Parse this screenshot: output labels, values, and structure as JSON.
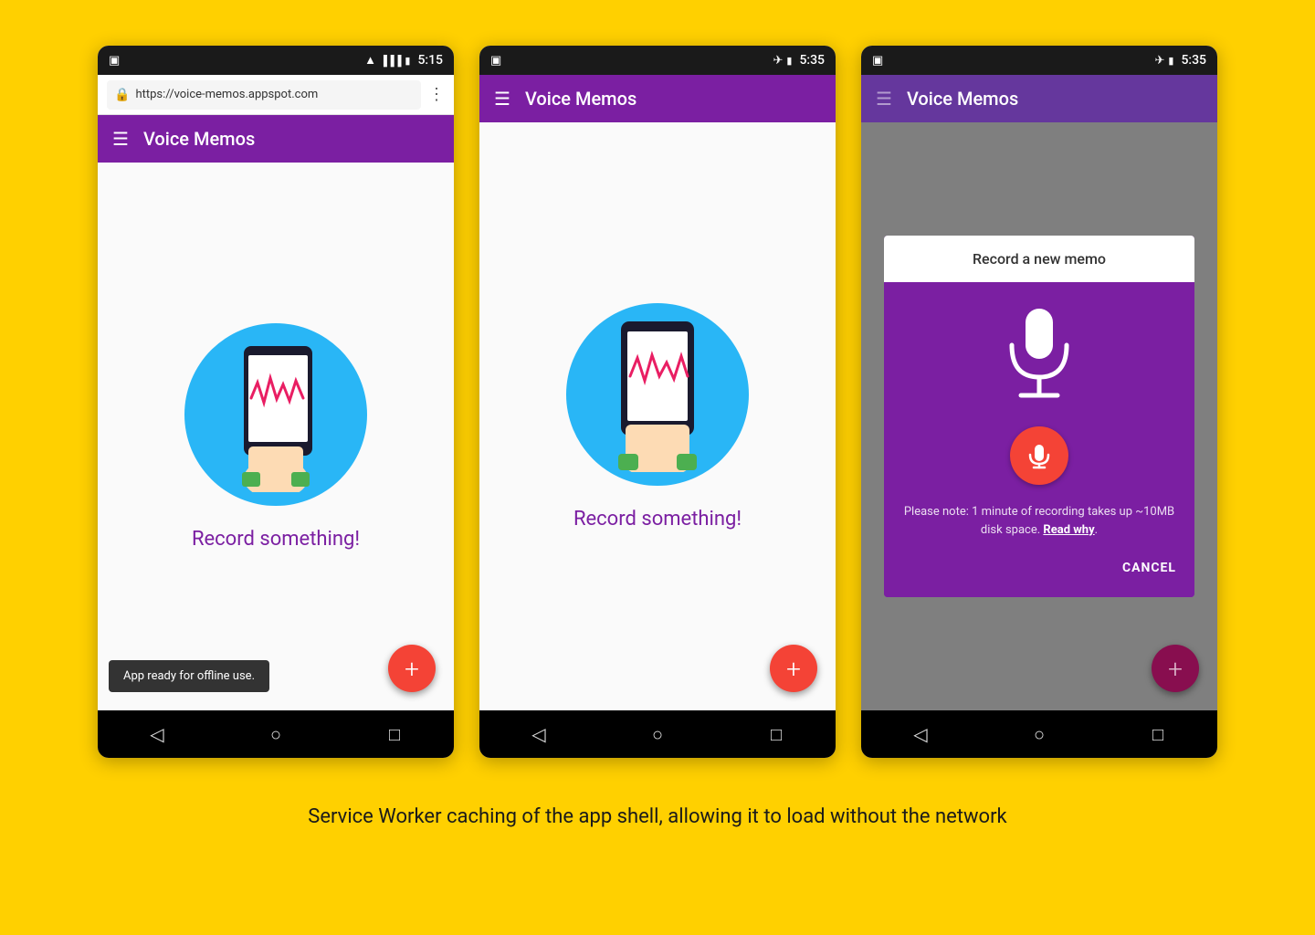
{
  "background": "#FFD000",
  "phones": [
    {
      "id": "phone1",
      "status_bar": {
        "left_icon": "tablet",
        "right_icons": [
          "wifi",
          "signal",
          "battery"
        ],
        "time": "5:15"
      },
      "has_browser_bar": true,
      "browser_url": "https://voice-memos.appspot.com",
      "app_bar": {
        "title": "Voice Memos",
        "icon": "menu"
      },
      "content": {
        "record_text": "Record something!",
        "has_illustration": true
      },
      "snackbar": "App ready for offline use.",
      "fab_label": "+",
      "nav": [
        "back",
        "home",
        "square"
      ]
    },
    {
      "id": "phone2",
      "status_bar": {
        "left_icon": "tablet",
        "right_icons": [
          "airplane",
          "battery"
        ],
        "time": "5:35"
      },
      "has_browser_bar": false,
      "app_bar": {
        "title": "Voice Memos",
        "icon": "menu"
      },
      "content": {
        "record_text": "Record something!",
        "has_illustration": true
      },
      "snackbar": null,
      "fab_label": "+",
      "nav": [
        "back",
        "home",
        "square"
      ]
    },
    {
      "id": "phone3",
      "status_bar": {
        "left_icon": "tablet",
        "right_icons": [
          "airplane",
          "battery"
        ],
        "time": "5:35"
      },
      "has_browser_bar": false,
      "app_bar": {
        "title": "Voice Memos",
        "icon": "menu",
        "dimmed": true
      },
      "dialog": {
        "title": "Record a new memo",
        "note": "Please note: 1 minute of recording takes up ~10MB disk space.",
        "read_why": "Read why",
        "cancel_label": "CANCEL"
      },
      "fab_label": "+",
      "nav": [
        "back",
        "home",
        "square"
      ]
    }
  ],
  "caption": "Service Worker caching of the app shell, allowing it to load without the network"
}
